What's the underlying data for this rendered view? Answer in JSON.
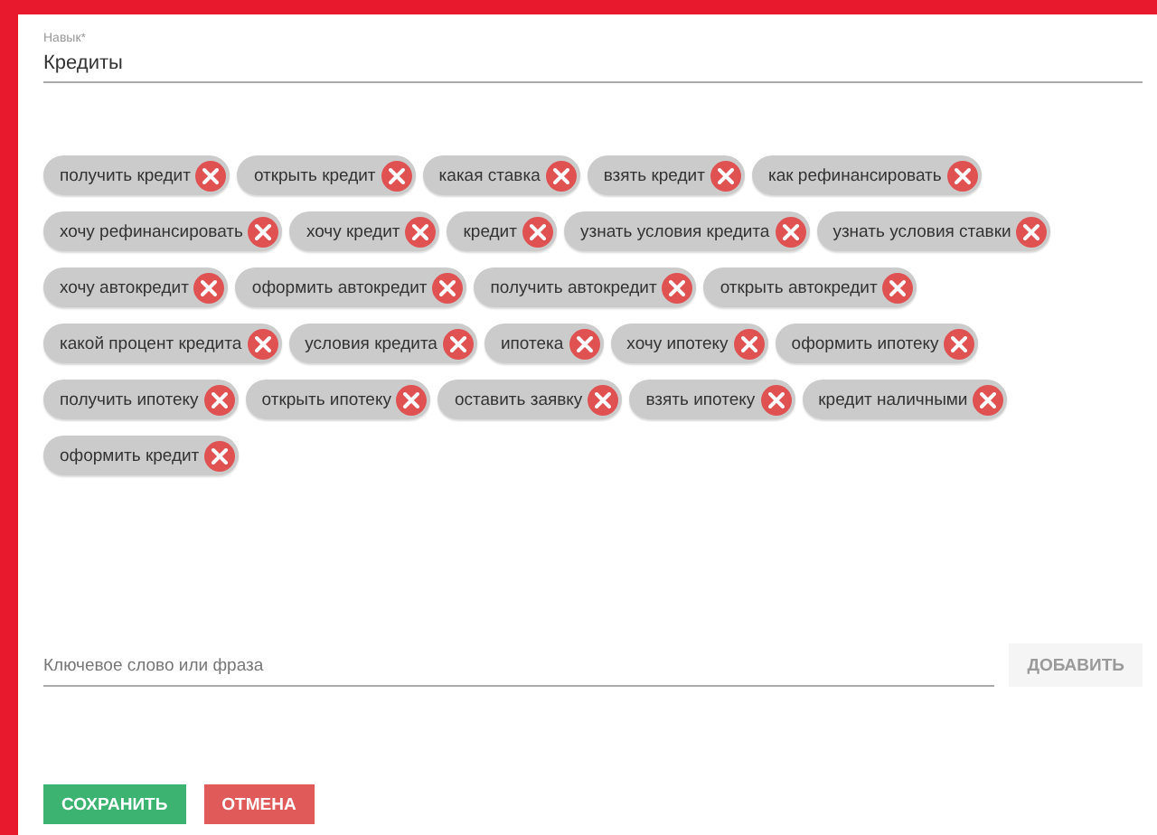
{
  "skill_field": {
    "label": "Навык*",
    "value": "Кредиты"
  },
  "tag_rows": [
    [
      "получить кредит",
      "открыть кредит",
      "какая ставка",
      "взять кредит",
      "как рефинансировать"
    ],
    [
      "хочу рефинансировать",
      "хочу кредит",
      "кредит",
      "узнать условия кредита",
      "узнать условия ставки"
    ],
    [
      "хочу автокредит",
      "оформить автокредит",
      "получить автокредит",
      "открыть автокредит"
    ],
    [
      "какой процент кредита",
      "условия кредита",
      "ипотека",
      "хочу ипотеку",
      "оформить ипотеку"
    ],
    [
      "получить ипотеку",
      "открыть ипотеку",
      "оставить заявку",
      "взять ипотеку",
      "кредит наличными"
    ],
    [
      "оформить кредит"
    ]
  ],
  "keyword_field": {
    "placeholder": "Ключевое слово или фраза"
  },
  "add_button": {
    "label": "ДОБАВИТЬ",
    "disabled": true
  },
  "buttons": [
    {
      "label": "СОХРАНИТЬ",
      "kind": "save"
    },
    {
      "label": "ОТМЕНА",
      "kind": "cancel"
    }
  ]
}
